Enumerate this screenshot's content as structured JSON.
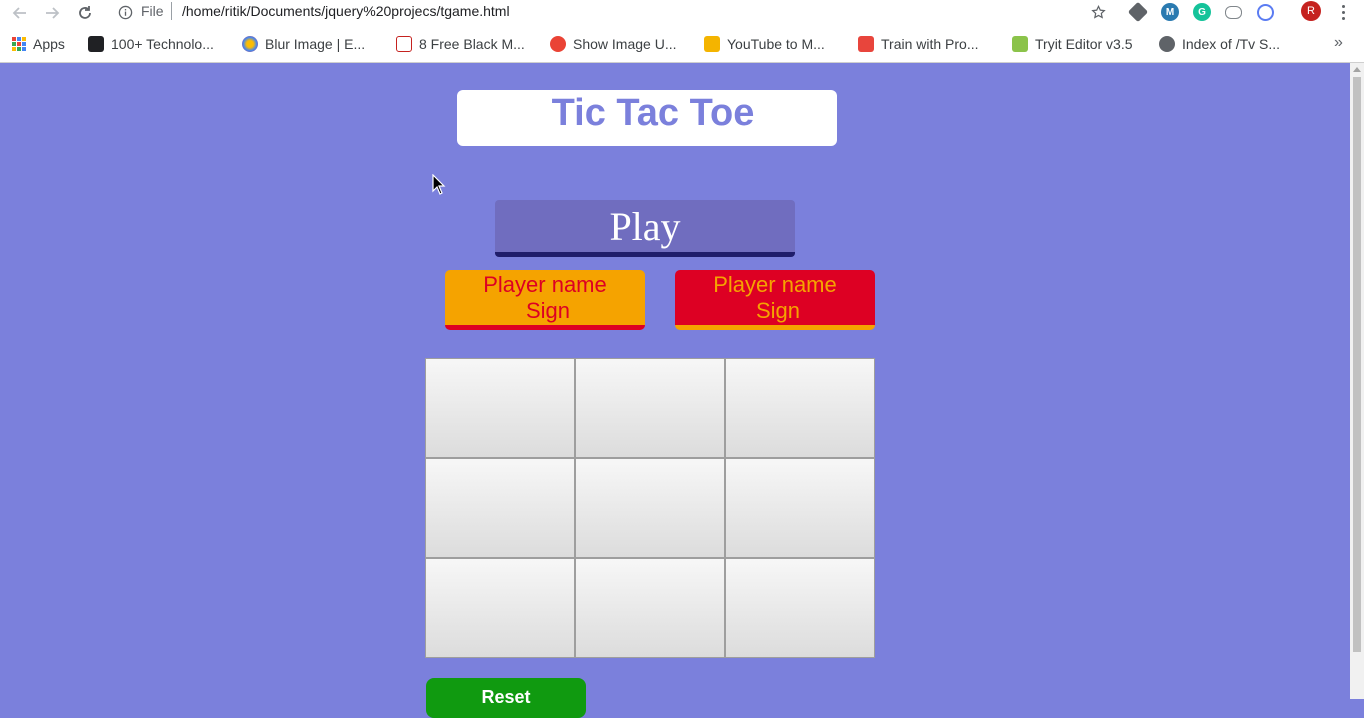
{
  "browser": {
    "url_scheme": "File",
    "url": "/home/ritik/Documents/jquery%20projecs/tgame.html",
    "profile_initial": "R",
    "bookmarks": [
      {
        "label": "Apps",
        "icon": "apps-grid-icon"
      },
      {
        "label": "100+ Technolo...",
        "icon": "camera-icon"
      },
      {
        "label": "Blur Image | E...",
        "icon": "blur-image-icon"
      },
      {
        "label": "8 Free Black M...",
        "icon": "g-site-icon"
      },
      {
        "label": "Show Image U...",
        "icon": "flower-icon"
      },
      {
        "label": "YouTube to M...",
        "icon": "youtube-mp3-icon"
      },
      {
        "label": "Train with Pro...",
        "icon": "train-icon"
      },
      {
        "label": "Tryit Editor v3.5",
        "icon": "w3schools-icon"
      },
      {
        "label": "Index of /Tv S...",
        "icon": "globe-icon"
      }
    ],
    "more_bookmarks": "»"
  },
  "game": {
    "title": "Tic Tac Toe",
    "play_label": "Play",
    "player1": {
      "name": "Player name",
      "sign": "Sign"
    },
    "player2": {
      "name": "Player name",
      "sign": "Sign"
    },
    "board_cells": [
      "",
      "",
      "",
      "",
      "",
      "",
      "",
      "",
      ""
    ],
    "reset_label": "Reset"
  },
  "colors": {
    "page_background": "#7b80dc",
    "play_button": "#706dbf",
    "player1_bg": "#f5a300",
    "player2_bg": "#dd0023",
    "reset_button": "#109a10"
  }
}
